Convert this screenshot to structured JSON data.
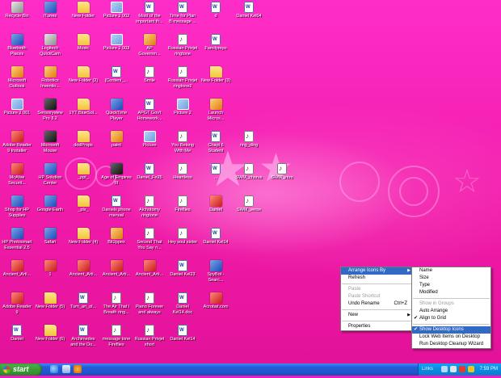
{
  "desktop": {
    "icons": [
      {
        "label": "Recycle Bin",
        "type": "gray"
      },
      {
        "label": "iTunes",
        "type": "app"
      },
      {
        "label": "New Folder",
        "type": "folder"
      },
      {
        "label": "Picture 2 002",
        "type": "pic"
      },
      {
        "label": "Most of the\nimportant th...",
        "type": "doc"
      },
      {
        "label": "Time for Plan\nB message ...",
        "type": "doc"
      },
      {
        "label": "d",
        "type": "doc"
      },
      {
        "label": "Daniel Kel04",
        "type": "doc"
      },
      {
        "label": "Bluetooth\nPlaces",
        "type": "app"
      },
      {
        "label": "Logitech\nQuickCam",
        "type": "gray"
      },
      {
        "label": "Music",
        "type": "folder"
      },
      {
        "label": "Picture 2 003",
        "type": "pic"
      },
      {
        "label": "AP\nGovernm...",
        "type": "orange"
      },
      {
        "label": "Russian Privjet\nringtone",
        "type": "sound"
      },
      {
        "label": "Familyrepo",
        "type": "doc"
      },
      {
        "label": "Microsoft\nOutlook",
        "type": "orange"
      },
      {
        "label": "Robotics\nInventio...",
        "type": "orange"
      },
      {
        "label": "New Folder (2)",
        "type": "folder"
      },
      {
        "label": "[Content_...",
        "type": "doc"
      },
      {
        "label": "Smile",
        "type": "sound"
      },
      {
        "label": "Russian Privjet\nringtone2",
        "type": "sound"
      },
      {
        "label": "New Folder (3)",
        "type": "folder"
      },
      {
        "label": "Picture 2 001",
        "type": "pic"
      },
      {
        "label": "Sensoryview\nPro 3.2",
        "type": "dark"
      },
      {
        "label": "1YT BlueSol...",
        "type": "folder"
      },
      {
        "label": "QuickTime\nPlayer",
        "type": "app"
      },
      {
        "label": "APGT Gov't\nHomework...",
        "type": "doc"
      },
      {
        "label": "Picture 2",
        "type": "pic"
      },
      {
        "label": "Launch\nMicros...",
        "type": "orange"
      },
      {
        "label": "Adobe Reader\n9 Installer",
        "type": "red"
      },
      {
        "label": "Microsoft\nMouse",
        "type": "dark"
      },
      {
        "label": "dodProps",
        "type": "folder"
      },
      {
        "label": "paint",
        "type": "orange"
      },
      {
        "label": "Picture",
        "type": "pic"
      },
      {
        "label": "You Belong\nWith Me",
        "type": "sound"
      },
      {
        "label": "Chapt 6\nStudent",
        "type": "doc"
      },
      {
        "label": "ring_ding",
        "type": "sound"
      },
      {
        "label": "McAfee\nSecurit...",
        "type": "red"
      },
      {
        "label": "HP Solution\nCenter",
        "type": "app"
      },
      {
        "label": "_ppt_",
        "type": "folder"
      },
      {
        "label": "Age of Empires\nIII",
        "type": "dark"
      },
      {
        "label": "Daniel_Fe25",
        "type": "doc"
      },
      {
        "label": "Heartless",
        "type": "sound"
      },
      {
        "label": "...",
        "type": "doc"
      },
      {
        "label": "SWM_chorus",
        "type": "sound"
      },
      {
        "label": "SWM_intro",
        "type": "sound"
      },
      {
        "label": "Shop for HP\nSupplies",
        "type": "app"
      },
      {
        "label": "Google Earth",
        "type": "app"
      },
      {
        "label": "_pls_",
        "type": "folder"
      },
      {
        "label": "Daniels phone\nmanual",
        "type": "doc"
      },
      {
        "label": "Alchotomy\nringtone",
        "type": "sound"
      },
      {
        "label": "Fireflies",
        "type": "sound"
      },
      {
        "label": "Daniel",
        "type": "red"
      },
      {
        "label": "SWM_verse",
        "type": "sound"
      },
      {
        "label": "HP Photosmart\nEssential 2.5",
        "type": "app"
      },
      {
        "label": "Safari",
        "type": "app"
      },
      {
        "label": "New Folder (4)",
        "type": "folder"
      },
      {
        "label": "Bit2ppex",
        "type": "orange"
      },
      {
        "label": "Second That\nYou Say n...",
        "type": "sound"
      },
      {
        "label": "Hey soul sister",
        "type": "sound"
      },
      {
        "label": "Daniel Kel14",
        "type": "doc"
      },
      {
        "label": "Ancient_Arti...",
        "type": "red"
      },
      {
        "label": "1",
        "type": "red"
      },
      {
        "label": "Ancient_Arti...",
        "type": "red"
      },
      {
        "label": "Ancient_Arti...",
        "type": "red"
      },
      {
        "label": "Ancient_Arti...",
        "type": "red"
      },
      {
        "label": "Daniel Kel23",
        "type": "doc"
      },
      {
        "label": "SpyBot -\nSearc...",
        "type": "app"
      },
      {
        "label": "Adobe Reader\n9",
        "type": "red"
      },
      {
        "label": "New Folder (5)",
        "type": "folder"
      },
      {
        "label": "Turn_an_ol...",
        "type": "doc"
      },
      {
        "label": "The Air That I\nBreath ring...",
        "type": "sound"
      },
      {
        "label": "Piano Forever\nand always",
        "type": "sound"
      },
      {
        "label": "Daniel\nKel14.doc",
        "type": "doc"
      },
      {
        "label": "Acrobat.com",
        "type": "red"
      },
      {
        "label": "Daniel",
        "type": "doc"
      },
      {
        "label": "New Folder (6)",
        "type": "folder"
      },
      {
        "label": "Archimedes\nand the Do...",
        "type": "doc"
      },
      {
        "label": "message tone\nFireflies",
        "type": "sound"
      },
      {
        "label": "Russian Privjet\nshort",
        "type": "sound"
      },
      {
        "label": "Daniel Kel14",
        "type": "doc"
      }
    ]
  },
  "context_menu": {
    "items": [
      {
        "label": "Arrange Icons By",
        "highlighted": true,
        "submenu": true
      },
      {
        "label": "Refresh"
      },
      {
        "separator": true
      },
      {
        "label": "Paste",
        "disabled": true
      },
      {
        "label": "Paste Shortcut",
        "disabled": true
      },
      {
        "label": "Undo Rename",
        "accelerator": "Ctrl+Z"
      },
      {
        "separator": true
      },
      {
        "label": "New",
        "submenu": true
      },
      {
        "separator": true
      },
      {
        "label": "Properties"
      }
    ]
  },
  "arrange_submenu": {
    "items": [
      {
        "label": "Name"
      },
      {
        "label": "Size"
      },
      {
        "label": "Type"
      },
      {
        "label": "Modified"
      },
      {
        "separator": true
      },
      {
        "label": "Show in Groups",
        "disabled": true
      },
      {
        "label": "Auto Arrange"
      },
      {
        "label": "Align to Grid",
        "checked": true
      },
      {
        "separator": true
      },
      {
        "label": "Show Desktop Icons",
        "checked": true,
        "highlighted": true
      },
      {
        "label": "Lock Web Items on Desktop"
      },
      {
        "label": "Run Desktop Cleanup Wizard"
      }
    ]
  },
  "taskbar": {
    "start_label": "start",
    "tray_links": "Links",
    "clock": "7:59 PM",
    "quick_launch": [
      "ie-icon",
      "show-desktop-icon",
      "media-player-icon"
    ],
    "tray_icons": [
      "network-icon",
      "volume-icon",
      "security-icon",
      "update-icon",
      "antivirus-icon"
    ]
  }
}
